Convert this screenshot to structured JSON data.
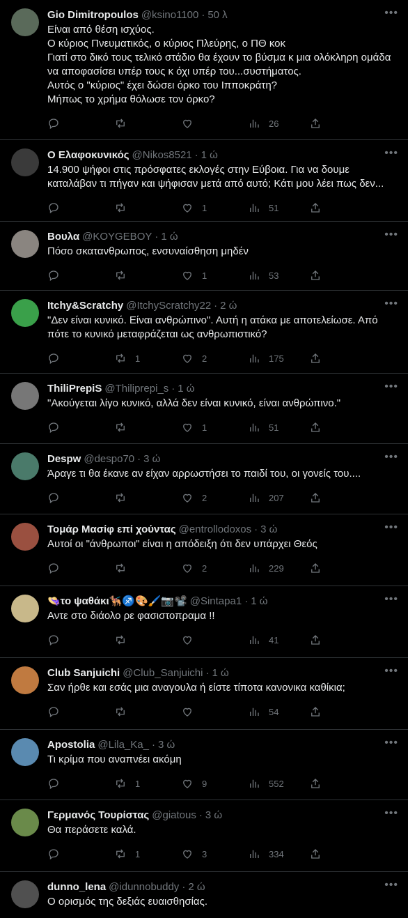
{
  "tweets": [
    {
      "name": "Gio Dimitropoulos",
      "handle": "@ksino1100",
      "time": "50 λ",
      "text": "Είναι από θέση ισχύος.\nΟ κύριος Πνευματικός, ο κύριος Πλεύρης, ο ΠΘ κοκ\nΓιατί στο δικό τους τελικό στάδιο θα έχουν το βύσμα κ μια ολόκληρη ομάδα να αποφασίσει υπέρ τους κ όχι υπέρ του...συστήματος.\nΑυτός ο \"κύριος\" έχει δώσει όρκο του Ιπποκράτη?\nΜήπως το χρήμα θόλωσε τον όρκο?",
      "replies": "",
      "retweets": "",
      "likes": "",
      "views": "26",
      "avatar_color": "#5a6a5a"
    },
    {
      "name": "Ο Ελαφοκυνικός",
      "handle": "@Nikos8521",
      "time": "1 ώ",
      "text": "14.900 ψήφοι στις πρόσφατες εκλογές στην Εύβοια. Για να δουμε καταλάβαν τι πήγαν και ψήφισαν μετά από αυτό; Κάτι μου λέει πως δεν...",
      "replies": "",
      "retweets": "",
      "likes": "1",
      "views": "51",
      "avatar_color": "#3a3a3a"
    },
    {
      "name": "Βουλα",
      "handle": "@KOYGEBOY",
      "time": "1 ώ",
      "text": "Πόσο σκατανθρωπος, ενσυναίσθηση μηδέν",
      "replies": "",
      "retweets": "",
      "likes": "1",
      "views": "53",
      "avatar_color": "#8a8580"
    },
    {
      "name": "Itchy&Scratchy",
      "handle": "@ItchyScratchy22",
      "time": "2 ώ",
      "text": "\"Δεν είναι κυνικό. Είναι ανθρώπινο\". Αυτή η ατάκα με αποτελείωσε. Από πότε το κυνικό μεταφράζεται ως ανθρωπιστικό?",
      "replies": "",
      "retweets": "1",
      "likes": "2",
      "views": "175",
      "avatar_color": "#3aa04a"
    },
    {
      "name": "ThiliPrepiS",
      "handle": "@Thiliprepi_s",
      "time": "1 ώ",
      "text": "\"Ακούγεται λίγο κυνικό, αλλά δεν είναι κυνικό, είναι ανθρώπινο.\"",
      "replies": "",
      "retweets": "",
      "likes": "1",
      "views": "51",
      "avatar_color": "#777777"
    },
    {
      "name": "Despw",
      "handle": "@despo70",
      "time": "3 ώ",
      "text": "Άραγε τι θα έκανε αν είχαν αρρωστήσει  το παιδί του, οι γονείς του....",
      "replies": "",
      "retweets": "",
      "likes": "2",
      "views": "207",
      "avatar_color": "#4a7a6a"
    },
    {
      "name": "Τομάρ Μασίφ επί χούντας",
      "handle": "@entrollodoxos",
      "time": "3 ώ",
      "text": "Αυτοί οι \"άνθρωποι\" είναι η απόδειξη ότι δεν υπάρχει Θεός",
      "replies": "",
      "retweets": "",
      "likes": "2",
      "views": "229",
      "avatar_color": "#9a5040"
    },
    {
      "name": "👒το ψαθάκι🐕‍🦺♐🎨🖌️📷📽️",
      "handle": "@Sintapa1",
      "time": "1 ώ",
      "text": "Αντε στο διάολο ρε φασιστοπραμα !!",
      "replies": "",
      "retweets": "",
      "likes": "",
      "views": "41",
      "avatar_color": "#c8b88a"
    },
    {
      "name": "Club Sanjuichi",
      "handle": "@Club_Sanjuichi",
      "time": "1 ώ",
      "text": "Σαν ήρθε και εσάς μια αναγουλα ή είστε τίποτα κανονικα καθίκια;",
      "replies": "",
      "retweets": "",
      "likes": "",
      "views": "54",
      "avatar_color": "#c07a40"
    },
    {
      "name": "Apostolia",
      "handle": "@Lila_Ka_",
      "time": "3 ώ",
      "text": "Τι κρίμα που αναπνέει ακόμη",
      "replies": "",
      "retweets": "1",
      "likes": "9",
      "views": "552",
      "avatar_color": "#5a8ab0"
    },
    {
      "name": "Γερμανός Τουρίστας",
      "handle": "@giatous",
      "time": "3 ώ",
      "text": "Θα περάσετε καλά.",
      "replies": "",
      "retweets": "1",
      "likes": "3",
      "views": "334",
      "avatar_color": "#6a8a4a"
    },
    {
      "name": "dunno_lena",
      "handle": "@idunnobuddy",
      "time": "2 ώ",
      "text": "Ο ορισμός της δεξιάς ευαισθησίας.",
      "replies": "",
      "retweets": "",
      "likes": "",
      "views": "",
      "avatar_color": "#505050"
    }
  ]
}
